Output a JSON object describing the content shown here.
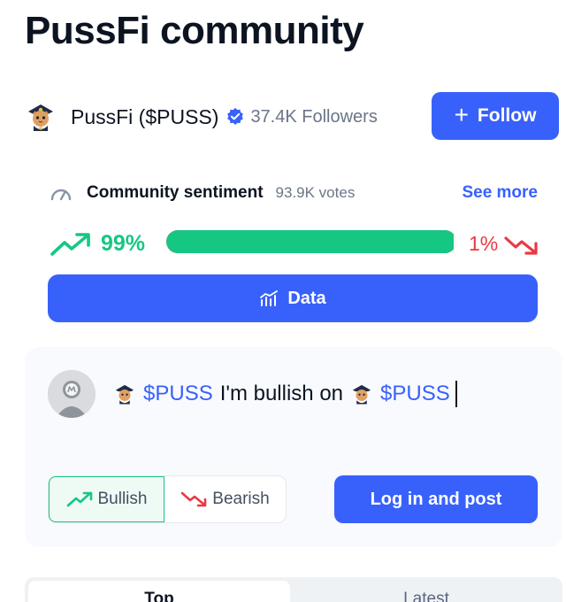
{
  "page": {
    "title": "PussFi community"
  },
  "token": {
    "name": "PussFi ($PUSS)",
    "followers": "37.4K Followers",
    "avatar_icon": "cat-sheriff-icon",
    "verified_icon": "verified-badge-icon"
  },
  "follow_button": {
    "label": "Follow",
    "icon": "plus-icon"
  },
  "sentiment": {
    "label": "Community sentiment",
    "votes": "93.9K votes",
    "see_more": "See more",
    "bullish_pct_label": "99%",
    "bearish_pct_label": "1%",
    "bullish_fraction": 0.99,
    "colors": {
      "bullish": "#16c784",
      "bearish": "#ea3943"
    }
  },
  "data_button": {
    "label": "Data",
    "icon": "chart-icon"
  },
  "composer": {
    "tag_1": "$PUSS",
    "text": "I'm bullish on",
    "tag_2": "$PUSS"
  },
  "vote_options": {
    "bullish": "Bullish",
    "bearish": "Bearish"
  },
  "login_button": {
    "label": "Log in and post"
  },
  "tabs": {
    "top": "Top",
    "latest": "Latest"
  },
  "colors": {
    "accent": "#3861fb",
    "text": "#0d1421",
    "muted": "#6b7587"
  }
}
